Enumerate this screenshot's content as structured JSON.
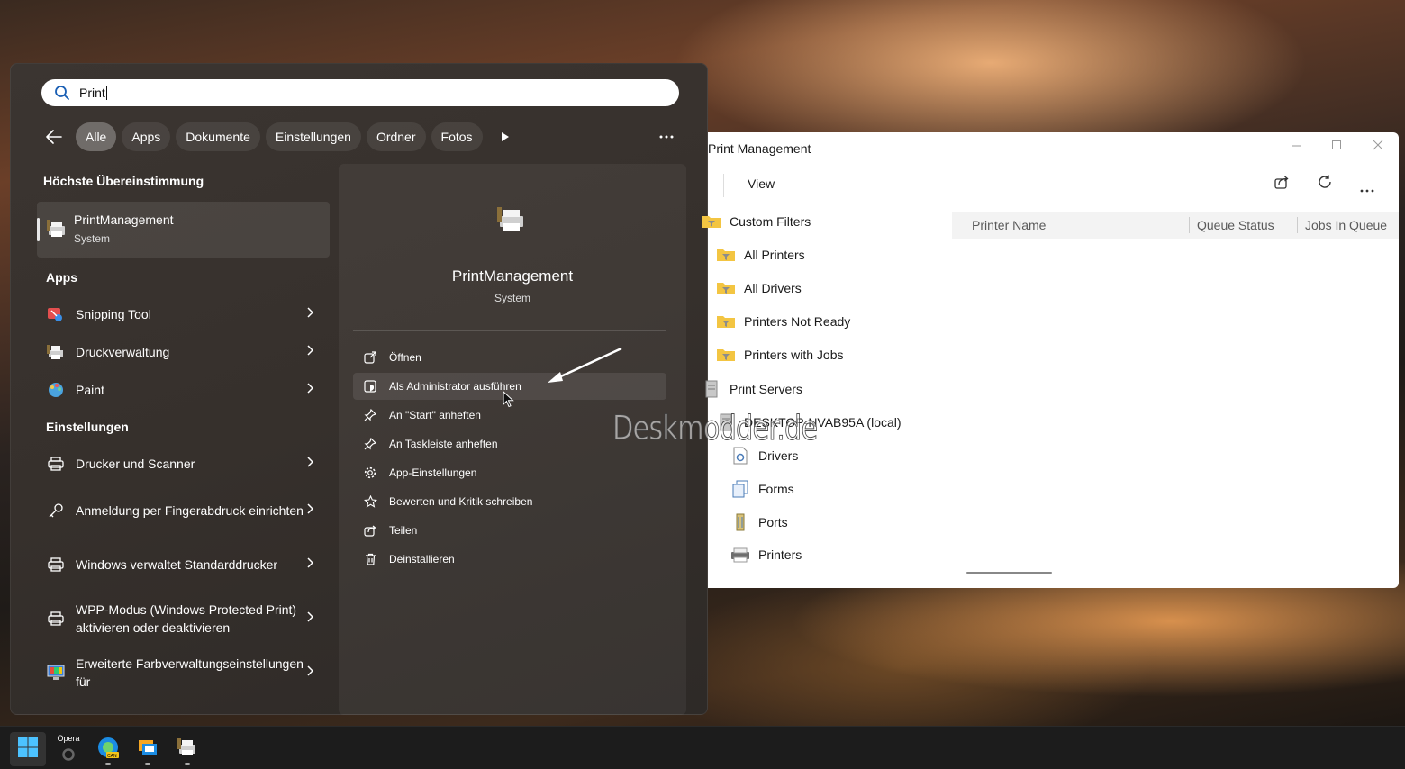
{
  "search": {
    "value": "Print"
  },
  "filters": [
    "Alle",
    "Apps",
    "Dokumente",
    "Einstellungen",
    "Ordner",
    "Fotos"
  ],
  "sections": {
    "best_match": "Höchste Übereinstimmung",
    "apps": "Apps",
    "settings": "Einstellungen"
  },
  "best_match": {
    "name": "PrintManagement",
    "sub": "System"
  },
  "apps": [
    {
      "label": "Snipping Tool",
      "icon": "snipping-tool-icon"
    },
    {
      "label": "Druckverwaltung",
      "icon": "print-management-icon"
    },
    {
      "label": "Paint",
      "icon": "paint-icon"
    }
  ],
  "settings": [
    {
      "label": "Drucker und Scanner",
      "icon": "printer-icon"
    },
    {
      "label": "Anmeldung per Fingerabdruck einrichten",
      "icon": "key-icon"
    },
    {
      "label": "Windows verwaltet Standarddrucker",
      "icon": "printer-icon"
    },
    {
      "label": "WPP-Modus (Windows Protected Print) aktivieren oder deaktivieren",
      "icon": "printer-icon"
    },
    {
      "label": "Erweiterte Farbverwaltungseinstellungen für",
      "icon": "color-monitor-icon"
    }
  ],
  "preview": {
    "name": "PrintManagement",
    "sub": "System",
    "actions": [
      {
        "label": "Öffnen",
        "icon": "open-icon"
      },
      {
        "label": "Als Administrator ausführen",
        "icon": "admin-shield-icon"
      },
      {
        "label": "An \"Start\" anheften",
        "icon": "pin-icon"
      },
      {
        "label": "An Taskleiste anheften",
        "icon": "pin-icon"
      },
      {
        "label": "App-Einstellungen",
        "icon": "gear-icon"
      },
      {
        "label": "Bewerten und Kritik schreiben",
        "icon": "star-icon"
      },
      {
        "label": "Teilen",
        "icon": "share-icon"
      },
      {
        "label": "Deinstallieren",
        "icon": "trash-icon"
      }
    ]
  },
  "window": {
    "title": "Print Management",
    "view": "View",
    "tree": [
      {
        "label": "Custom Filters",
        "level": 0
      },
      {
        "label": "All Printers",
        "level": 1
      },
      {
        "label": "All Drivers",
        "level": 1
      },
      {
        "label": "Printers Not Ready",
        "level": 1
      },
      {
        "label": "Printers with Jobs",
        "level": 1
      },
      {
        "label": "Print Servers",
        "level": 0
      },
      {
        "label": "DESKTOP-NVAB95A (local)",
        "level": 1
      },
      {
        "label": "Drivers",
        "level": 2
      },
      {
        "label": "Forms",
        "level": 2
      },
      {
        "label": "Ports",
        "level": 2
      },
      {
        "label": "Printers",
        "level": 2
      }
    ],
    "columns": [
      "Printer Name",
      "Queue Status",
      "Jobs In Queue"
    ]
  },
  "watermark": "Deskmodder.de",
  "taskbar": {
    "opera_label": "Opera"
  }
}
